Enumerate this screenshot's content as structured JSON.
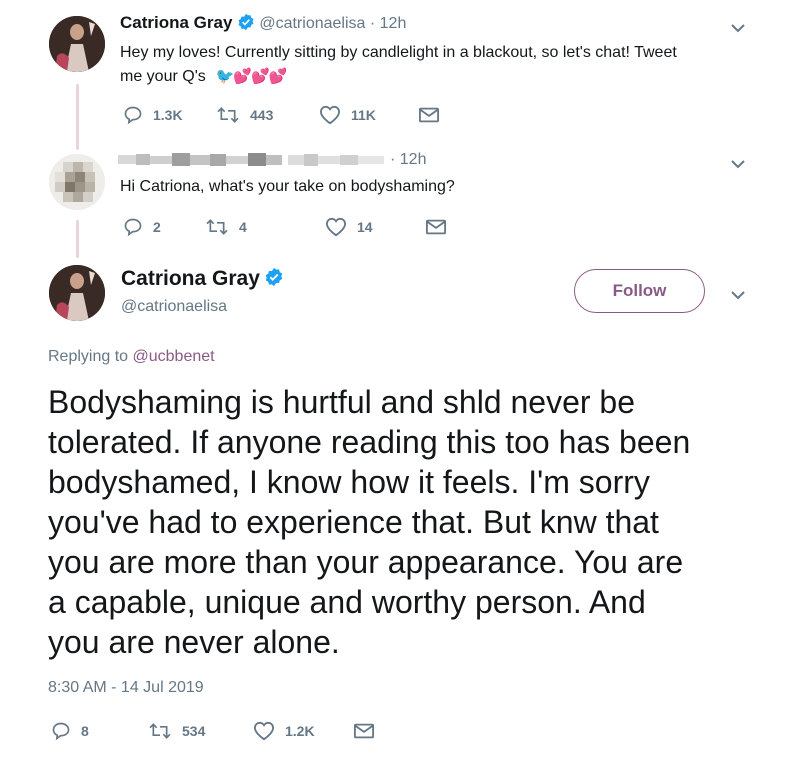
{
  "tweet1": {
    "name": "Catriona Gray",
    "handle": "@catrionaelisa",
    "time": " · 12h",
    "text_line1": "Hey my loves! Currently sitting by candlelight in a blackout, so let's chat! Tweet",
    "text_line2": "me your Q's",
    "emoji": "🐦💕💕💕",
    "replies": "1.3K",
    "retweets": "443",
    "likes": "11K"
  },
  "tweet2": {
    "time": "· 12h",
    "text": "Hi Catriona, what's your take on bodyshaming?",
    "replies": "2",
    "retweets": "4",
    "likes": "14"
  },
  "main": {
    "name": "Catriona Gray",
    "handle": "@catrionaelisa",
    "follow_label": "Follow",
    "replying_prefix": "Replying to ",
    "replying_handle": "@ucbbenet",
    "body": [
      "Bodyshaming is hurtful and shld never be",
      "tolerated. If anyone reading this too has been",
      "bodyshamed, I know how it feels. I'm sorry",
      "you've had to experience that. But knw that",
      "you are more than your appearance. You are",
      "a capable, unique and worthy person. And",
      "you are never alone."
    ],
    "timestamp": "8:30 AM - 14 Jul 2019",
    "replies": "8",
    "retweets": "534",
    "likes": "1.2K"
  },
  "colors": {
    "accent": "#8a5a86",
    "verified": "#1da1f2",
    "muted": "#657786",
    "thread_line": "#e8d3df"
  },
  "icons": [
    "reply-icon",
    "retweet-icon",
    "like-icon",
    "message-icon",
    "chevron-down-icon",
    "verified-badge-icon"
  ]
}
